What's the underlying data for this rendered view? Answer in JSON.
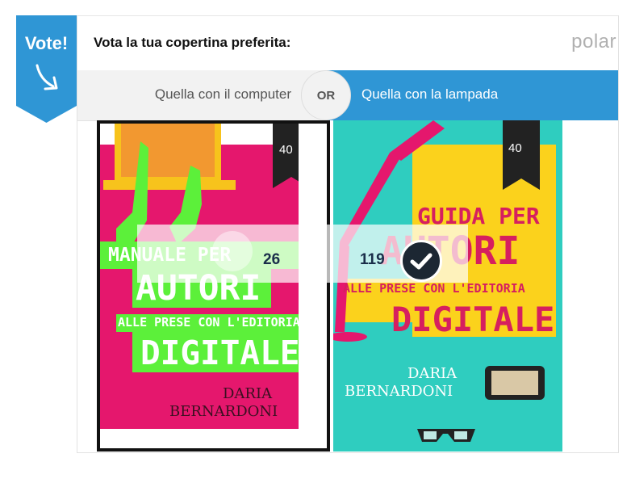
{
  "vote_tab": {
    "label": "Vote!",
    "icon": "arrow-down-right-icon",
    "color": "#2f96d5"
  },
  "header": {
    "question": "Vota la tua copertina preferita:",
    "brand": "polar"
  },
  "options": {
    "left_label": "Quella con il computer",
    "or_label": "OR",
    "right_label": "Quella con la lampada",
    "selected": "right",
    "accent_color": "#2f96d5"
  },
  "covers": {
    "left": {
      "title_line1": "MANUALE PER",
      "title_line2": "AUTORI",
      "subtitle": "ALLE PRESE CON L'EDITORIA",
      "title_line3": "DIGITALE",
      "author_first": "DARIA",
      "author_last": "BERNARDONI",
      "badge": "40",
      "votes": "26",
      "colors": {
        "background": "#e5176d",
        "accent": "#5cf03a",
        "laptop": "#f7c31c"
      }
    },
    "right": {
      "title_line1": "GUIDA PER",
      "title_line2": "AUTORI",
      "subtitle": "ALLE PRESE CON L'EDITORIA",
      "title_line3": "DIGITALE",
      "author_first": "DARIA",
      "author_last": "BERNARDONI",
      "badge": "40",
      "votes": "119",
      "colors": {
        "background": "#2fcdbf",
        "accent": "#fbd21c",
        "text": "#d61f5f"
      }
    }
  }
}
